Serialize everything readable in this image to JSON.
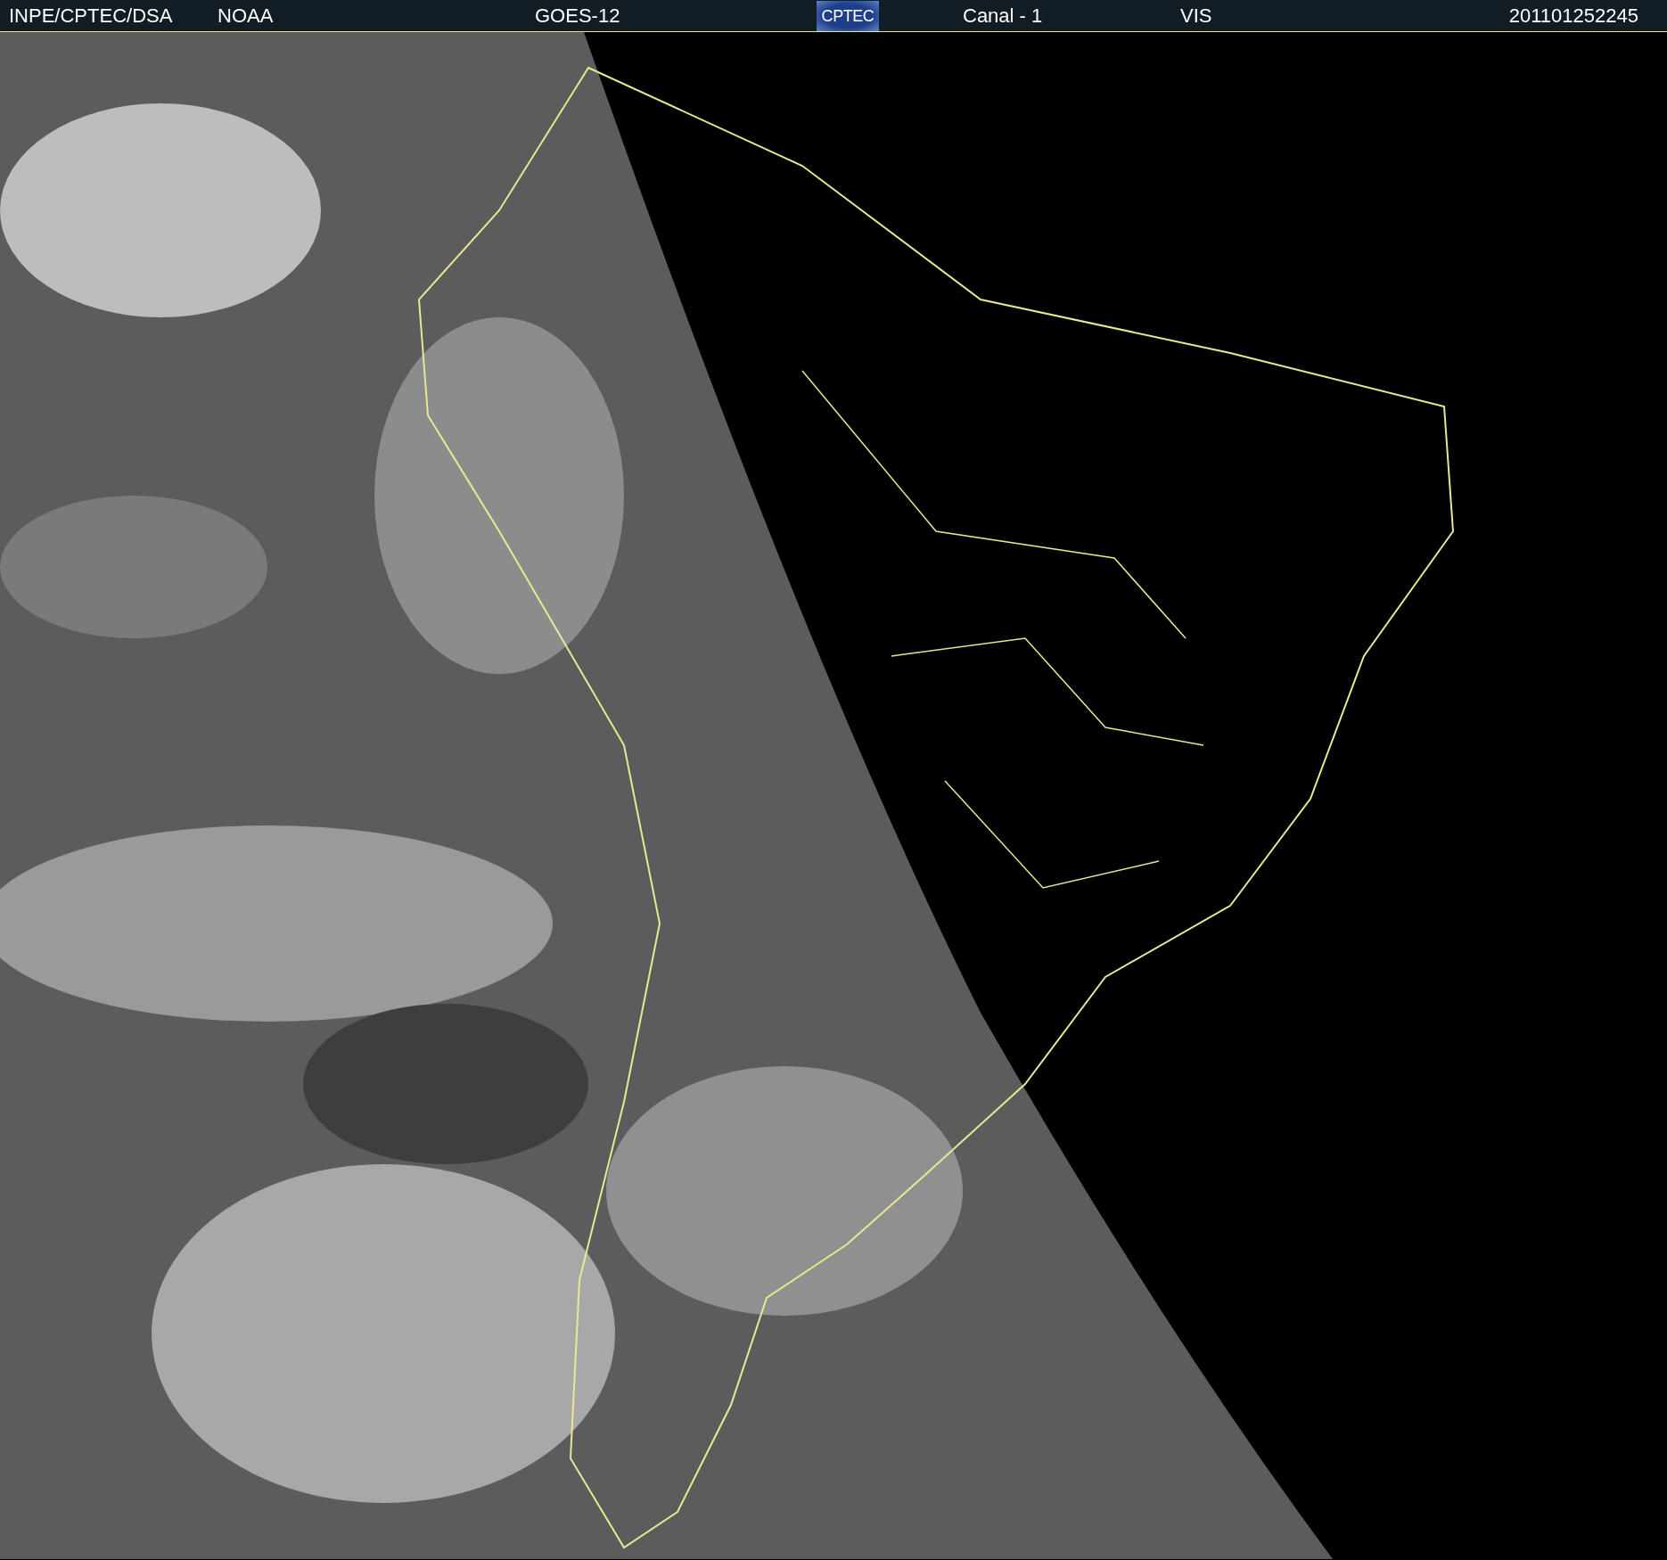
{
  "header": {
    "items": [
      {
        "kind": "text",
        "text": "INPE/CPTEC/DSA"
      },
      {
        "kind": "text",
        "text": "NOAA"
      },
      {
        "kind": "text",
        "text": "GOES-12"
      },
      {
        "kind": "logo",
        "text": "CPTEC"
      },
      {
        "kind": "text",
        "text": "Canal - 1"
      },
      {
        "kind": "text",
        "text": "VIS"
      },
      {
        "kind": "text",
        "text": "201101252245"
      }
    ]
  }
}
